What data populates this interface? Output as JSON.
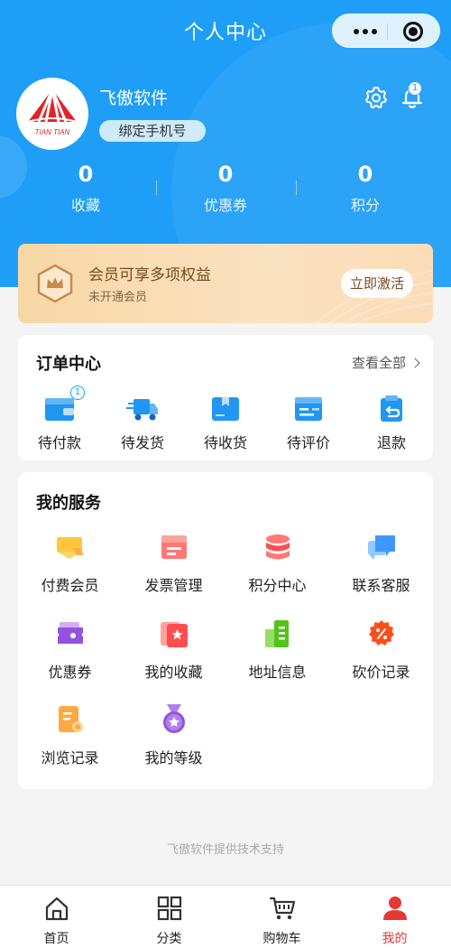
{
  "nav": {
    "title": "个人中心"
  },
  "user": {
    "name": "飞傲软件",
    "bind_phone": "绑定手机号",
    "logo_text": "TIAN TIAN",
    "notification_count": "1"
  },
  "stats": [
    {
      "value": "0",
      "label": "收藏"
    },
    {
      "value": "0",
      "label": "优惠券"
    },
    {
      "value": "0",
      "label": "积分"
    }
  ],
  "vip": {
    "title": "会员可享多项权益",
    "subtitle": "未开通会员",
    "button": "立即激活"
  },
  "orders": {
    "title": "订单中心",
    "see_all": "查看全部",
    "items": [
      {
        "label": "待付款",
        "icon": "wallet-icon",
        "badge": "1"
      },
      {
        "label": "待发货",
        "icon": "truck-icon"
      },
      {
        "label": "待收货",
        "icon": "box-icon"
      },
      {
        "label": "待评价",
        "icon": "comment-card-icon"
      },
      {
        "label": "退款",
        "icon": "refund-icon"
      }
    ]
  },
  "services": {
    "title": "我的服务",
    "items": [
      {
        "label": "付费会员",
        "icon": "vip-card-icon"
      },
      {
        "label": "发票管理",
        "icon": "invoice-icon"
      },
      {
        "label": "积分中心",
        "icon": "points-stack-icon"
      },
      {
        "label": "联系客服",
        "icon": "chat-icon"
      },
      {
        "label": "优惠券",
        "icon": "coupon-icon"
      },
      {
        "label": "我的收藏",
        "icon": "favorite-icon"
      },
      {
        "label": "地址信息",
        "icon": "address-icon"
      },
      {
        "label": "砍价记录",
        "icon": "bargain-icon"
      },
      {
        "label": "浏览记录",
        "icon": "history-icon"
      },
      {
        "label": "我的等级",
        "icon": "level-medal-icon"
      }
    ]
  },
  "footer_note": "飞傲软件提供技术支持",
  "tabbar": [
    {
      "label": "首页",
      "icon": "home-icon"
    },
    {
      "label": "分类",
      "icon": "grid-icon"
    },
    {
      "label": "购物车",
      "icon": "cart-icon"
    },
    {
      "label": "我的",
      "icon": "user-icon",
      "active": true
    }
  ],
  "colors": {
    "primary": "#1e9ef6",
    "active_tab": "#e53935",
    "vip_text": "#7a4a1f"
  }
}
